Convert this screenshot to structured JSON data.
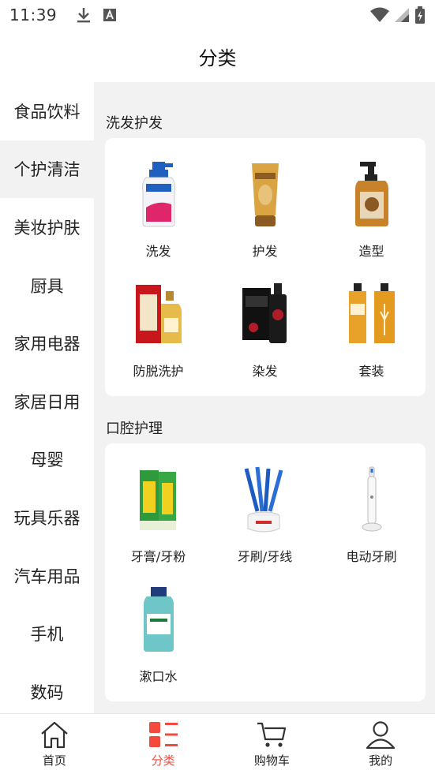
{
  "status": {
    "time": "11:39"
  },
  "header": {
    "title": "分类"
  },
  "sidebar": {
    "items": [
      {
        "label": "食品饮料"
      },
      {
        "label": "个护清洁"
      },
      {
        "label": "美妆护肤"
      },
      {
        "label": "厨具"
      },
      {
        "label": "家用电器"
      },
      {
        "label": "家居日用"
      },
      {
        "label": "母婴"
      },
      {
        "label": "玩具乐器"
      },
      {
        "label": "汽车用品"
      },
      {
        "label": "手机"
      },
      {
        "label": "数码"
      }
    ],
    "active": "个护清洁"
  },
  "sections": [
    {
      "title": "洗发护发",
      "items": [
        {
          "label": "洗发",
          "icon": "shampoo-icon"
        },
        {
          "label": "护发",
          "icon": "conditioner-tube-icon"
        },
        {
          "label": "造型",
          "icon": "styling-pump-bottle-icon"
        },
        {
          "label": "防脱洗护",
          "icon": "anti-hair-loss-set-icon"
        },
        {
          "label": "染发",
          "icon": "hair-dye-icon"
        },
        {
          "label": "套装",
          "icon": "hair-care-set-icon"
        }
      ]
    },
    {
      "title": "口腔护理",
      "items": [
        {
          "label": "牙膏/牙粉",
          "icon": "toothpaste-icon"
        },
        {
          "label": "牙刷/牙线",
          "icon": "toothbrush-icon"
        },
        {
          "label": "电动牙刷",
          "icon": "electric-toothbrush-icon"
        },
        {
          "label": "漱口水",
          "icon": "mouthwash-icon"
        }
      ]
    }
  ],
  "bottom_nav": {
    "items": [
      {
        "label": "首页",
        "icon": "home-icon"
      },
      {
        "label": "分类",
        "icon": "category-icon"
      },
      {
        "label": "购物车",
        "icon": "cart-icon"
      },
      {
        "label": "我的",
        "icon": "profile-icon"
      }
    ],
    "active": "分类"
  },
  "colors": {
    "accent": "#f24b3e",
    "panel_bg": "#f2f2f2"
  }
}
